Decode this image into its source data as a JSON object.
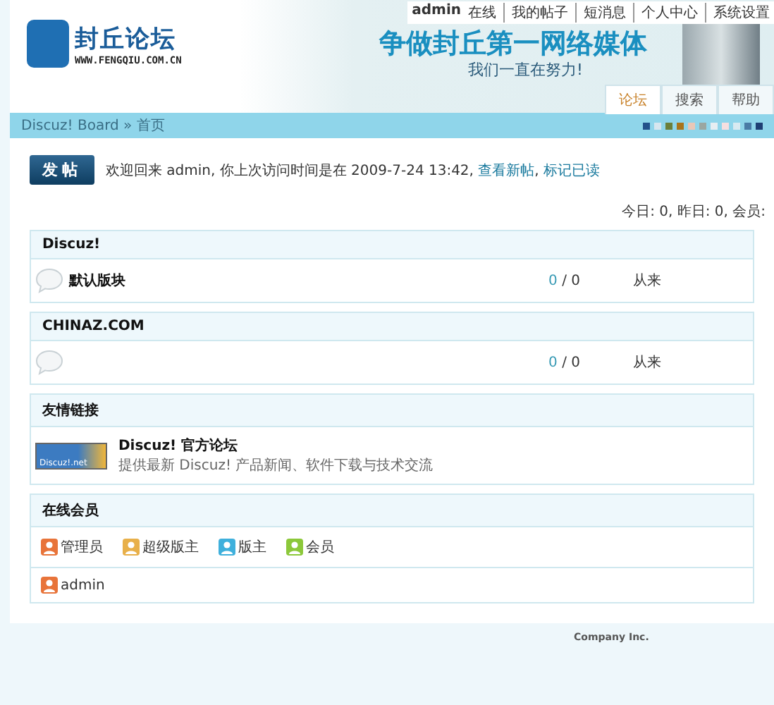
{
  "top_links": [
    {
      "text": "admin",
      "kind": "user"
    },
    {
      "text": "在线",
      "kind": "plain"
    },
    {
      "text": "我的帖子",
      "kind": "link"
    },
    {
      "text": "短消息",
      "kind": "link"
    },
    {
      "text": "个人中心",
      "kind": "link"
    },
    {
      "text": "系统设置",
      "kind": "link"
    }
  ],
  "logo": {
    "name": "封丘论坛",
    "url": "WWW.FENGQIU.COM.CN"
  },
  "banner": {
    "slogan": "争做封丘第一网络媒体",
    "subline": "我们一直在努力!"
  },
  "tabs": [
    {
      "label": "论坛",
      "selected": true
    },
    {
      "label": "搜索",
      "selected": false
    },
    {
      "label": "帮助",
      "selected": false
    }
  ],
  "breadcrumb": {
    "root": "Discuz! Board",
    "separator": "»",
    "current": "首页"
  },
  "theme_swatches": [
    {
      "color": "#23508a"
    },
    {
      "color": "#d6e6ef"
    },
    {
      "color": "#6b7f3a"
    },
    {
      "color": "#a9741c"
    },
    {
      "color": "#e9c7b7"
    },
    {
      "color": "#9aa6a0"
    },
    {
      "color": "#e6eef2"
    },
    {
      "color": "#f6dfe0"
    },
    {
      "color": "#d8eaf1"
    },
    {
      "color": "#4a7ba6"
    },
    {
      "color": "#1e3f74"
    }
  ],
  "post_button": "发帖",
  "welcome": {
    "text": "欢迎回来  admin, 你上次访问时间是在  2009-7-24 13:42,",
    "links": [
      "查看新帖",
      "标记已读"
    ],
    "link_separator": ","
  },
  "stats": "今日: 0, 昨日: 0, 会员:",
  "categories": [
    {
      "title": "Discuz!",
      "forums": [
        {
          "name": "默认版块",
          "today": "0",
          "separator": "/",
          "total": "0",
          "last": "从来"
        }
      ]
    },
    {
      "title": "CHINAZ.COM",
      "forums": [
        {
          "today": "0",
          "separator": "/",
          "total": "0",
          "last": "从来"
        }
      ]
    }
  ],
  "links_section": {
    "title": "友情链接",
    "items": [
      {
        "logo_text": "Discuz!.net",
        "name": "Discuz! 官方论坛",
        "desc": "提供最新  Discuz! 产品新闻、软件下载与技术交流"
      }
    ]
  },
  "online": {
    "title": "在线会员",
    "legend": [
      {
        "label": "管理员",
        "color": "#e8743a"
      },
      {
        "label": "超级版主",
        "color": "#e8b04a"
      },
      {
        "label": "版主",
        "color": "#3fb0dc"
      },
      {
        "label": "会员",
        "color": "#8cc83a"
      }
    ],
    "members": [
      {
        "name": "admin",
        "color": "#e8743a"
      }
    ]
  },
  "footer": {
    "company": "Company Inc."
  }
}
